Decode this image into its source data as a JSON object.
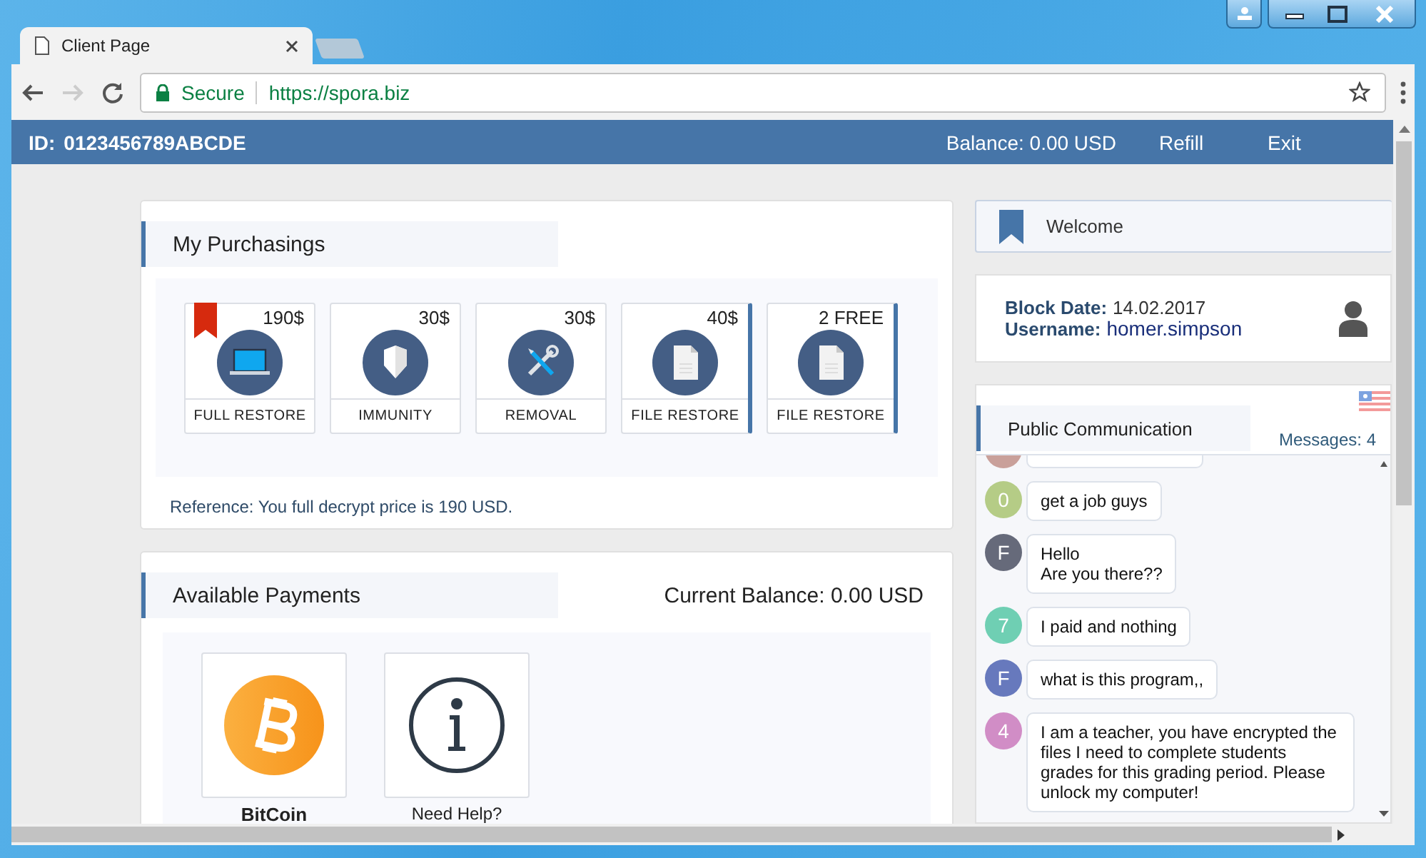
{
  "browser": {
    "tab_title": "Client Page",
    "secure_label": "Secure",
    "url": "https://spora.biz"
  },
  "header": {
    "id_label": "ID:",
    "id": "0123456789ABCDE",
    "balance": "Balance: 0.00 USD",
    "links": [
      "Refill",
      "Exit"
    ]
  },
  "purchasings": {
    "title": "My Purchasings",
    "items": [
      {
        "price": "190$",
        "label": "FULL RESTORE",
        "kind": "laptop",
        "flagged": true,
        "accent": false
      },
      {
        "price": "30$",
        "label": "IMMUNITY",
        "kind": "shield",
        "flagged": false,
        "accent": false
      },
      {
        "price": "30$",
        "label": "REMOVAL",
        "kind": "tools",
        "flagged": false,
        "accent": false
      },
      {
        "price": "40$",
        "label": "FILE RESTORE",
        "kind": "document",
        "flagged": false,
        "accent": true
      },
      {
        "price": "2 FREE",
        "label": "FILE RESTORE",
        "kind": "document",
        "flagged": false,
        "accent": true
      }
    ],
    "reference": "Reference: You full decrypt price is 190 USD."
  },
  "payments": {
    "title": "Available Payments",
    "balance": "Current Balance: 0.00 USD",
    "options": [
      {
        "label": "BitCoin",
        "kind": "bitcoin"
      },
      {
        "label": "Need Help?",
        "kind": "info"
      }
    ]
  },
  "welcome": {
    "title": "Welcome"
  },
  "account": {
    "block_date_label": "Block Date:",
    "block_date": "14.02.2017",
    "username_label": "Username:",
    "username": "homer.simpson"
  },
  "chat": {
    "title": "Public Communication",
    "count": "Messages: 4",
    "messages": [
      {
        "kind": "clipped",
        "color": "#c9a09a"
      },
      {
        "kind": "message",
        "avatar": "0",
        "color": "#b5cc86",
        "text": "get a job guys"
      },
      {
        "kind": "message",
        "avatar": "F",
        "color": "#666a7a",
        "text": "Hello\nAre you there??"
      },
      {
        "kind": "message",
        "avatar": "7",
        "color": "#6fcfb3",
        "text": "I paid and nothing"
      },
      {
        "kind": "message",
        "avatar": "F",
        "color": "#6779bd",
        "text": "what is this program,,"
      },
      {
        "kind": "message",
        "avatar": "4",
        "color": "#d18dc6",
        "text": "I am a teacher, you have encrypted the files I need to complete students grades for this grading period. Please unlock my computer!"
      }
    ]
  }
}
